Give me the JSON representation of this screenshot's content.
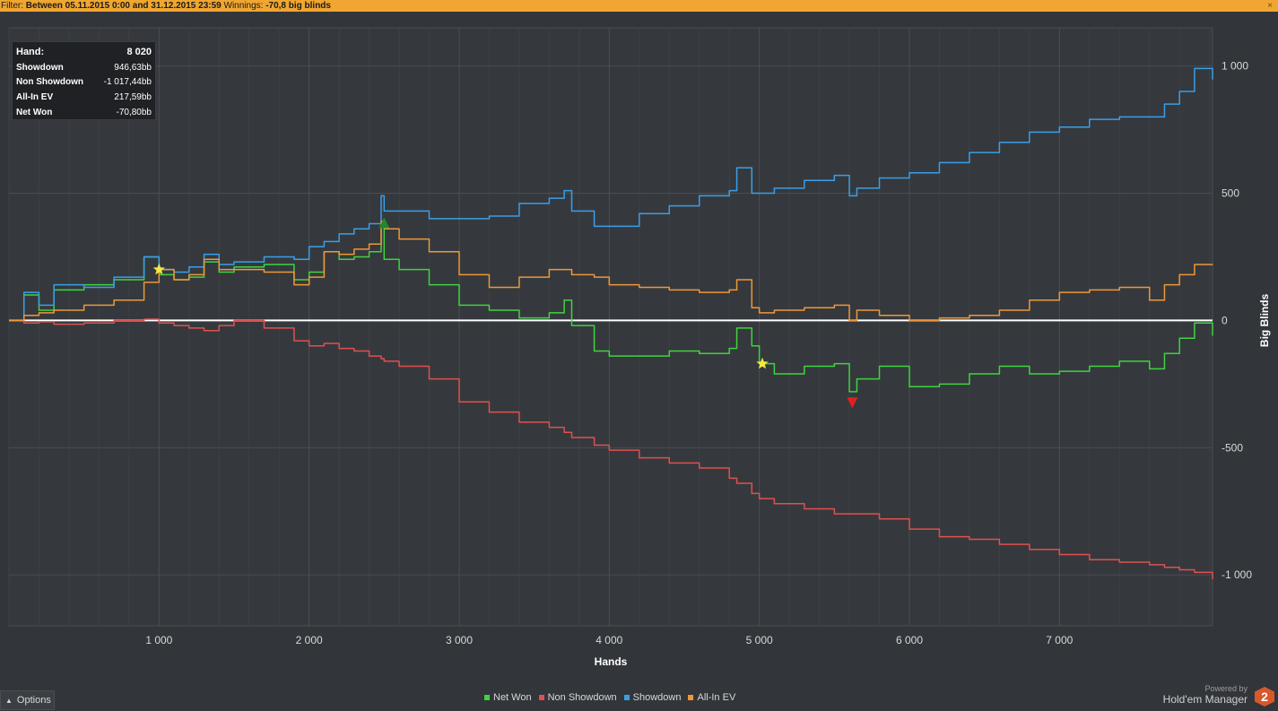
{
  "filter_bar": {
    "prefix": "Filter:",
    "range": "Between 05.11.2015 0:00 and 31.12.2015 23:59",
    "winnings_label": "Winnings:",
    "winnings_value": "-70,8 big blinds",
    "close_glyph": "×"
  },
  "stats": [
    {
      "label": "Hand:",
      "value": "8 020"
    },
    {
      "label": "Showdown",
      "value": "946,63bb"
    },
    {
      "label": "Non Showdown",
      "value": "-1 017,44bb"
    },
    {
      "label": "All-In EV",
      "value": "217,59bb"
    },
    {
      "label": "Net Won",
      "value": "-70,80bb"
    }
  ],
  "footer": {
    "options_label": "Options",
    "options_icon": "chevron-up-icon",
    "powered_by": "Powered by",
    "brand_name": "Hold'em Manager",
    "brand_logo": "2"
  },
  "chart_data": {
    "type": "line",
    "xlabel": "Hands",
    "ylabel": "Big Blinds",
    "xlim": [
      0,
      8020
    ],
    "ylim": [
      -1200,
      1150
    ],
    "x_ticks": [
      1000,
      2000,
      3000,
      4000,
      5000,
      6000,
      7000
    ],
    "x_tick_labels": [
      "1 000",
      "2 000",
      "3 000",
      "4 000",
      "5 000",
      "6 000",
      "7 000"
    ],
    "y_ticks": [
      1000,
      500,
      0,
      -500,
      -1000
    ],
    "y_tick_labels": [
      "1 000",
      "500",
      "0",
      "-500",
      "-1 000"
    ],
    "grid": true,
    "legend_position": "bottom-center",
    "x": [
      0,
      100,
      200,
      300,
      500,
      700,
      900,
      1000,
      1100,
      1200,
      1300,
      1400,
      1500,
      1700,
      1900,
      2000,
      2100,
      2200,
      2300,
      2400,
      2480,
      2500,
      2600,
      2800,
      3000,
      3200,
      3400,
      3600,
      3700,
      3750,
      3900,
      4000,
      4200,
      4400,
      4600,
      4800,
      4850,
      4950,
      5000,
      5100,
      5300,
      5500,
      5600,
      5650,
      5800,
      6000,
      6200,
      6400,
      6600,
      6800,
      7000,
      7200,
      7400,
      7600,
      7700,
      7800,
      7900,
      8020
    ],
    "series": [
      {
        "name": "Net Won",
        "color": "#3ed43e",
        "values": [
          0,
          100,
          40,
          120,
          140,
          160,
          250,
          180,
          160,
          170,
          230,
          190,
          210,
          220,
          160,
          190,
          270,
          240,
          250,
          270,
          370,
          240,
          200,
          140,
          60,
          40,
          10,
          30,
          80,
          -20,
          -120,
          -140,
          -140,
          -120,
          -130,
          -110,
          -30,
          -100,
          -170,
          -210,
          -180,
          -170,
          -280,
          -230,
          -180,
          -260,
          -250,
          -210,
          -180,
          -210,
          -200,
          -180,
          -160,
          -190,
          -130,
          -70,
          -10,
          -60
        ]
      },
      {
        "name": "Non Showdown",
        "color": "#e05050",
        "values": [
          0,
          -10,
          -5,
          -15,
          -10,
          0,
          5,
          -10,
          -20,
          -30,
          -40,
          -20,
          0,
          -30,
          -80,
          -100,
          -90,
          -110,
          -120,
          -140,
          -150,
          -160,
          -180,
          -230,
          -320,
          -360,
          -400,
          -420,
          -440,
          -460,
          -490,
          -510,
          -540,
          -560,
          -580,
          -620,
          -640,
          -680,
          -700,
          -720,
          -740,
          -760,
          -760,
          -760,
          -780,
          -820,
          -850,
          -860,
          -880,
          -900,
          -920,
          -940,
          -950,
          -960,
          -970,
          -980,
          -990,
          -1017
        ]
      },
      {
        "name": "Showdown",
        "color": "#3a9ee8",
        "values": [
          0,
          110,
          60,
          140,
          130,
          170,
          250,
          200,
          190,
          210,
          260,
          220,
          230,
          250,
          240,
          290,
          310,
          340,
          360,
          380,
          490,
          430,
          430,
          400,
          400,
          410,
          460,
          480,
          510,
          430,
          370,
          370,
          420,
          450,
          490,
          510,
          600,
          500,
          500,
          520,
          550,
          570,
          490,
          520,
          560,
          580,
          620,
          660,
          700,
          740,
          760,
          790,
          800,
          800,
          850,
          900,
          990,
          947
        ]
      },
      {
        "name": "All-In EV",
        "color": "#f0963a",
        "values": [
          0,
          20,
          30,
          40,
          60,
          80,
          150,
          200,
          160,
          180,
          240,
          200,
          200,
          190,
          140,
          170,
          270,
          260,
          280,
          300,
          390,
          360,
          320,
          270,
          180,
          130,
          170,
          200,
          200,
          180,
          170,
          140,
          130,
          120,
          110,
          120,
          160,
          50,
          30,
          40,
          50,
          60,
          0,
          40,
          20,
          0,
          10,
          20,
          40,
          80,
          110,
          120,
          130,
          80,
          140,
          180,
          220,
          218
        ]
      }
    ],
    "markers": [
      {
        "type": "star",
        "color": "#f4e842",
        "x": 1000,
        "y": 200
      },
      {
        "type": "triangle-up",
        "color": "#1e8a2e",
        "x": 2500,
        "y": 380
      },
      {
        "type": "star",
        "color": "#f4e842",
        "x": 5020,
        "y": -170
      },
      {
        "type": "triangle-down",
        "color": "#e02020",
        "x": 5620,
        "y": -320
      }
    ]
  }
}
